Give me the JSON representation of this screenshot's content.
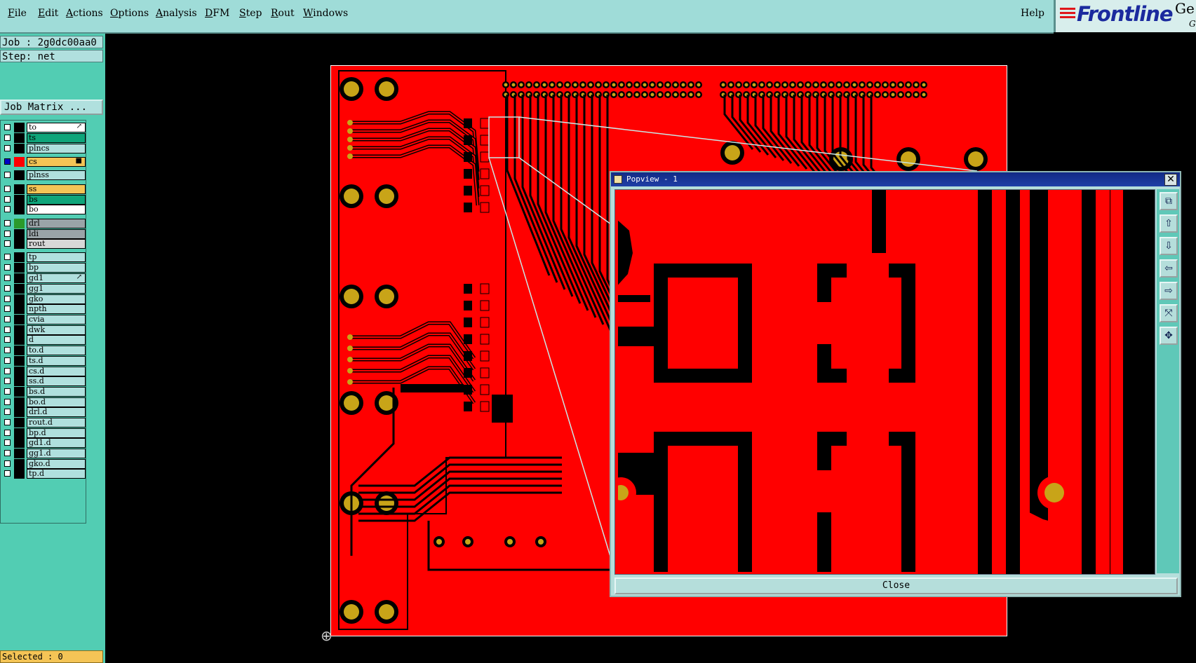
{
  "menu": {
    "items": [
      "File",
      "Edit",
      "Actions",
      "Options",
      "Analysis",
      "DFM",
      "Step",
      "Rout",
      "Windows"
    ],
    "help": "Help"
  },
  "logo": {
    "text": "Frontline",
    "side_text": "Ge",
    "side_sub": "G"
  },
  "job": {
    "job_line": "Job : 2g0dc00aa0",
    "step_line": "Step: net",
    "matrix_button": "Job Matrix ..."
  },
  "layers": [
    {
      "name": "to",
      "color": "#ffffff",
      "checked": false,
      "swatch": "#000000",
      "mark": "↗"
    },
    {
      "name": "ts",
      "color": "#0fa57a",
      "checked": false,
      "swatch": "#000000",
      "mark": ""
    },
    {
      "name": "plncs",
      "color": "#b0e0de",
      "checked": false,
      "swatch": "#000000",
      "mark": ""
    },
    {
      "name": "cs",
      "color": "#f4c456",
      "checked": true,
      "swatch": "#ff0000",
      "mark": "■"
    },
    {
      "name": "plnss",
      "color": "#b0e0de",
      "checked": false,
      "swatch": "#000000",
      "mark": ""
    },
    {
      "name": "ss",
      "color": "#f4c456",
      "checked": false,
      "swatch": "#000000",
      "mark": ""
    },
    {
      "name": "bs",
      "color": "#0fa57a",
      "checked": false,
      "swatch": "#000000",
      "mark": ""
    },
    {
      "name": "bo",
      "color": "#ffffff",
      "checked": false,
      "swatch": "#000000",
      "mark": ""
    },
    {
      "name": "drl",
      "color": "#9aa4a8",
      "checked": false,
      "swatch": "#2b9a2b",
      "mark": ""
    },
    {
      "name": "ldi",
      "color": "#9aa4a8",
      "checked": false,
      "swatch": "#000000",
      "mark": ""
    },
    {
      "name": "rout",
      "color": "#d8d8d8",
      "checked": false,
      "swatch": "#000000",
      "mark": ""
    },
    {
      "name": "tp",
      "color": "#b0e0de",
      "checked": false,
      "swatch": "#000000",
      "mark": ""
    },
    {
      "name": "bp",
      "color": "#b0e0de",
      "checked": false,
      "swatch": "#000000",
      "mark": ""
    },
    {
      "name": "gd1",
      "color": "#b0e0de",
      "checked": false,
      "swatch": "#000000",
      "mark": "↗"
    },
    {
      "name": "gg1",
      "color": "#b0e0de",
      "checked": false,
      "swatch": "#000000",
      "mark": ""
    },
    {
      "name": "gko",
      "color": "#b0e0de",
      "checked": false,
      "swatch": "#000000",
      "mark": ""
    },
    {
      "name": "npth",
      "color": "#b0e0de",
      "checked": false,
      "swatch": "#000000",
      "mark": ""
    },
    {
      "name": "cvia",
      "color": "#b0e0de",
      "checked": false,
      "swatch": "#000000",
      "mark": ""
    },
    {
      "name": "dwk",
      "color": "#b0e0de",
      "checked": false,
      "swatch": "#000000",
      "mark": ""
    },
    {
      "name": "d",
      "color": "#b0e0de",
      "checked": false,
      "swatch": "#000000",
      "mark": ""
    },
    {
      "name": "to.d",
      "color": "#b0e0de",
      "checked": false,
      "swatch": "#000000",
      "mark": ""
    },
    {
      "name": "ts.d",
      "color": "#b0e0de",
      "checked": false,
      "swatch": "#000000",
      "mark": ""
    },
    {
      "name": "cs.d",
      "color": "#b0e0de",
      "checked": false,
      "swatch": "#000000",
      "mark": ""
    },
    {
      "name": "ss.d",
      "color": "#b0e0de",
      "checked": false,
      "swatch": "#000000",
      "mark": ""
    },
    {
      "name": "bs.d",
      "color": "#b0e0de",
      "checked": false,
      "swatch": "#000000",
      "mark": ""
    },
    {
      "name": "bo.d",
      "color": "#b0e0de",
      "checked": false,
      "swatch": "#000000",
      "mark": ""
    },
    {
      "name": "drl.d",
      "color": "#b0e0de",
      "checked": false,
      "swatch": "#000000",
      "mark": ""
    },
    {
      "name": "rout.d",
      "color": "#b0e0de",
      "checked": false,
      "swatch": "#000000",
      "mark": ""
    },
    {
      "name": "bp.d",
      "color": "#b0e0de",
      "checked": false,
      "swatch": "#000000",
      "mark": ""
    },
    {
      "name": "gd1.d",
      "color": "#b0e0de",
      "checked": false,
      "swatch": "#000000",
      "mark": ""
    },
    {
      "name": "gg1.d",
      "color": "#b0e0de",
      "checked": false,
      "swatch": "#000000",
      "mark": ""
    },
    {
      "name": "gko.d",
      "color": "#b0e0de",
      "checked": false,
      "swatch": "#000000",
      "mark": ""
    },
    {
      "name": "tp.d",
      "color": "#b0e0de",
      "checked": false,
      "swatch": "#000000",
      "mark": ""
    }
  ],
  "status": {
    "selected": "Selected : 0"
  },
  "popview": {
    "title": "Popview - 1",
    "close_button": "Close",
    "tools": [
      "zoom-window-icon",
      "pan-up-icon",
      "pan-down-icon",
      "pan-left-icon",
      "pan-right-icon",
      "zoom-fit-icon",
      "zoom-home-icon"
    ]
  },
  "colors": {
    "copper": "#ff0000",
    "pad": "#c8a418",
    "ui_teal": "#9fdcd8"
  }
}
